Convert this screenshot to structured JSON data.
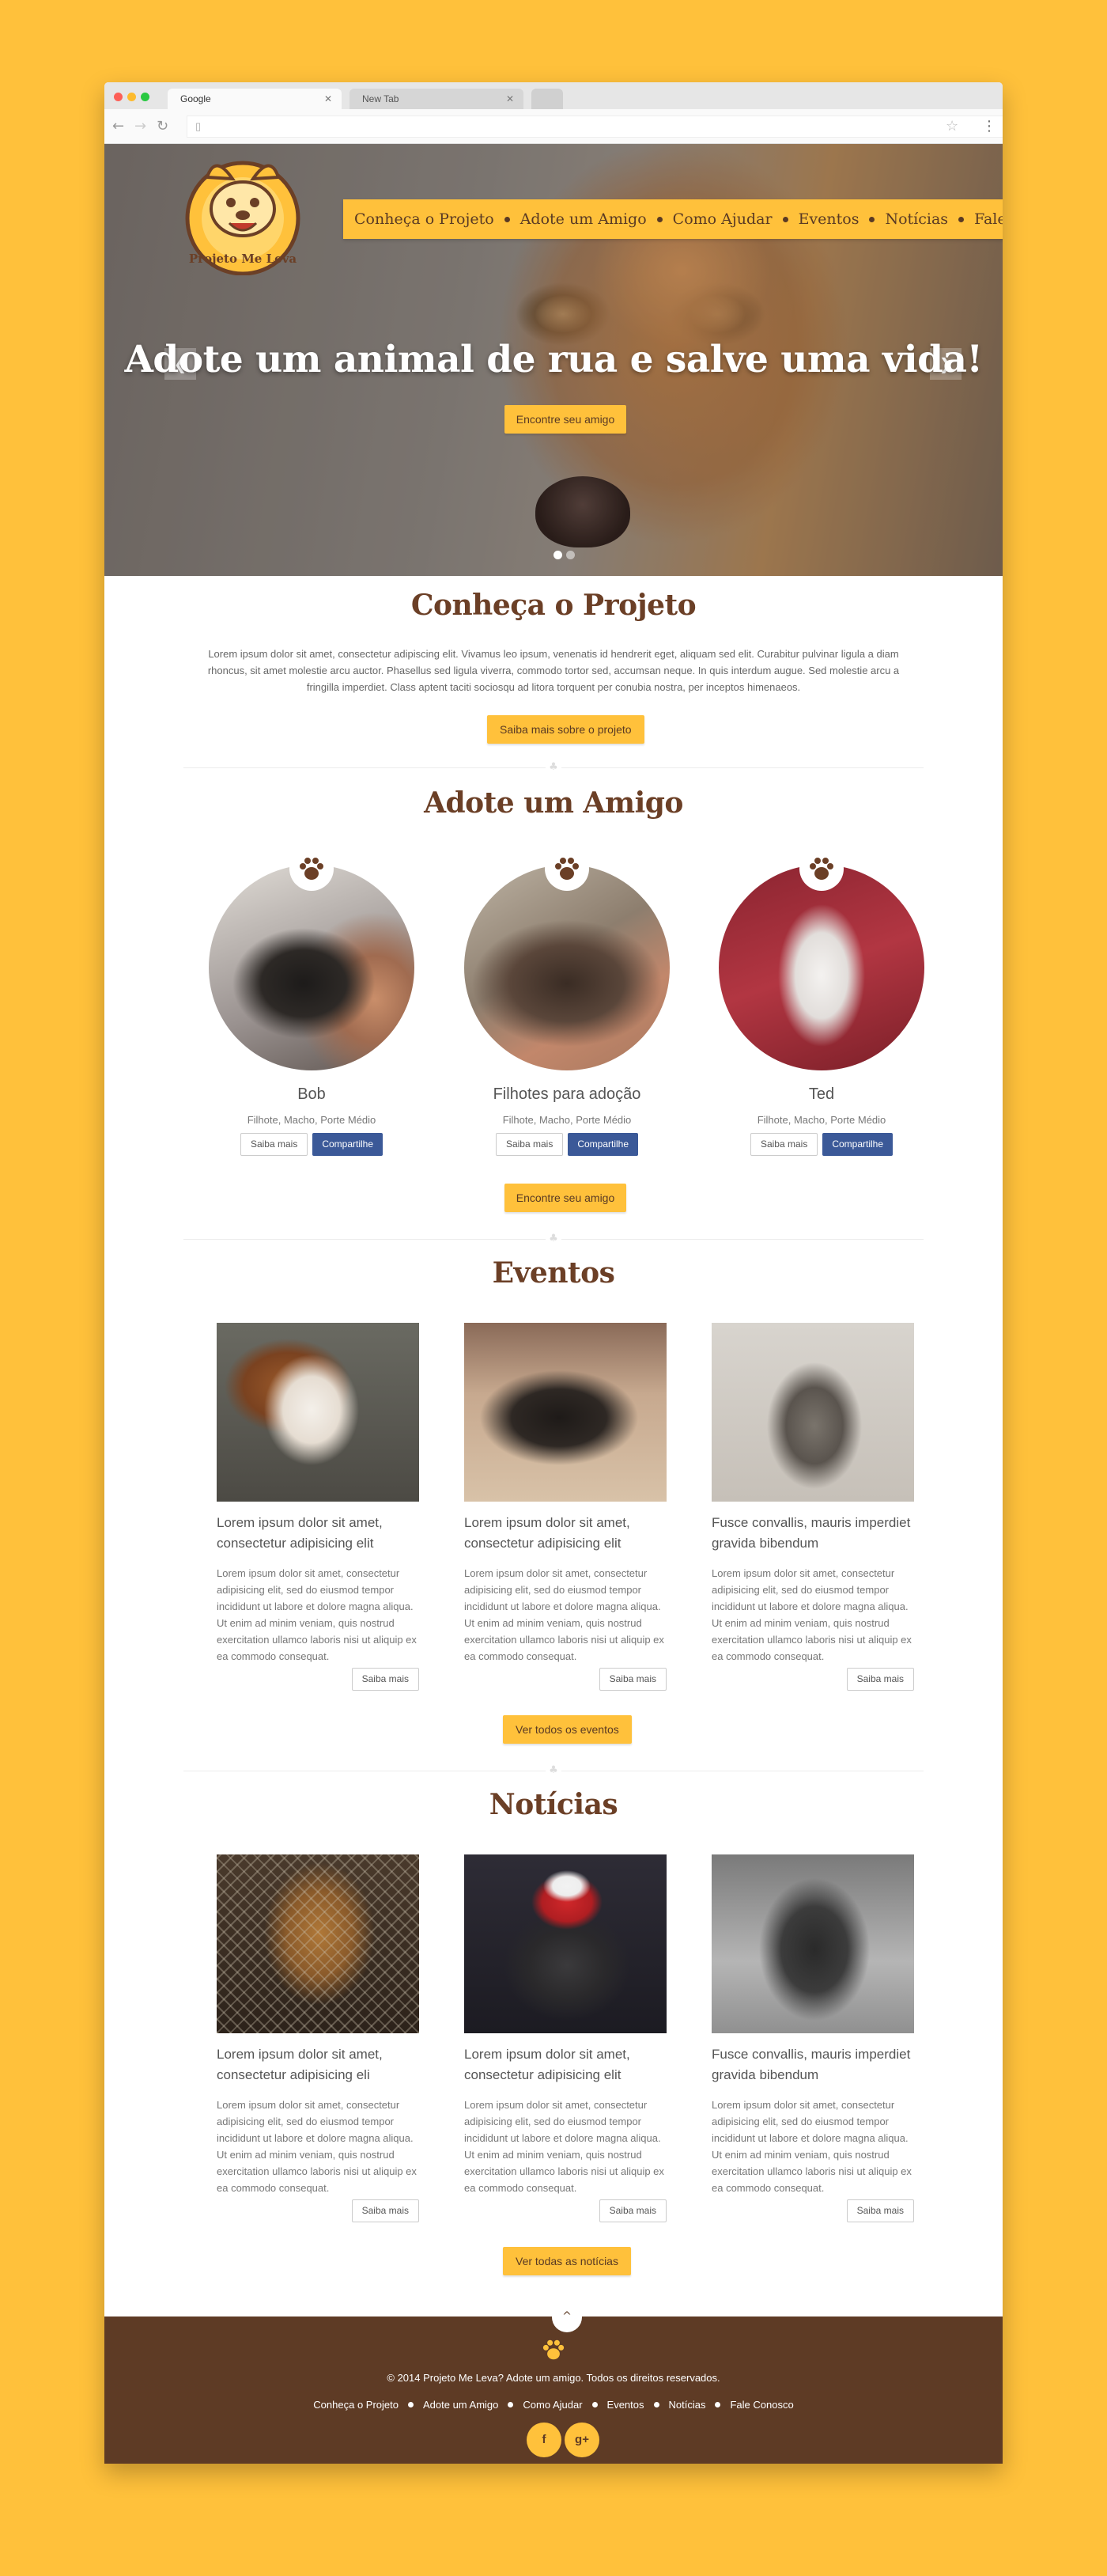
{
  "browser": {
    "tabs": [
      {
        "label": "Google"
      },
      {
        "label": "New Tab"
      }
    ]
  },
  "header": {
    "logo_text": "Projeto Me Leva",
    "menu": [
      {
        "label": "Conheça o Projeto"
      },
      {
        "label": "Adote um Amigo"
      },
      {
        "label": "Como Ajudar"
      },
      {
        "label": "Eventos"
      },
      {
        "label": "Notícias"
      },
      {
        "label": "Fale Conosco"
      }
    ]
  },
  "hero": {
    "title": "Adote um animal de rua e salve uma vida!",
    "button": "Encontre seu amigo",
    "slide_count": 2,
    "active_slide": 1
  },
  "about": {
    "title": "Conheça o Projeto",
    "paragraph": "Lorem ipsum dolor sit amet, consectetur adipiscing elit. Vivamus leo ipsum, venenatis id hendrerit eget, aliquam sed elit. Curabitur pulvinar ligula a diam rhoncus, sit amet molestie arcu auctor. Phasellus sed ligula viverra, commodo tortor sed, accumsan neque. In quis interdum augue. Sed molestie arcu a fringilla imperdiet. Class aptent taciti sociosqu ad litora torquent per conubia nostra, per inceptos himenaeos.",
    "button": "Saiba mais sobre o projeto"
  },
  "adopt": {
    "title": "Adote um Amigo",
    "pets": [
      {
        "name": "Bob",
        "desc": "Filhote, Macho, Porte Médio",
        "more": "Saiba mais",
        "share": "Compartilhe"
      },
      {
        "name": "Filhotes para adoção",
        "desc": "Filhote, Macho, Porte Médio",
        "more": "Saiba mais",
        "share": "Compartilhe"
      },
      {
        "name": "Ted",
        "desc": "Filhote, Macho, Porte Médio",
        "more": "Saiba mais",
        "share": "Compartilhe"
      }
    ],
    "button": "Encontre seu amigo"
  },
  "events": {
    "title": "Eventos",
    "items": [
      {
        "title": "Lorem ipsum dolor sit amet, consectetur adipisicing elit",
        "text": "Lorem ipsum dolor sit amet, consectetur adipisicing elit, sed do eiusmod tempor incididunt ut labore et dolore magna aliqua. Ut enim ad minim veniam, quis nostrud exercitation ullamco laboris nisi ut aliquip ex ea commodo consequat.",
        "more": "Saiba mais"
      },
      {
        "title": "Lorem ipsum dolor sit amet, consectetur adipisicing elit",
        "text": "Lorem ipsum dolor sit amet, consectetur adipisicing elit, sed do eiusmod tempor incididunt ut labore et dolore magna aliqua. Ut enim ad minim veniam, quis nostrud exercitation ullamco laboris nisi ut aliquip ex ea commodo consequat.",
        "more": "Saiba mais"
      },
      {
        "title": "Fusce convallis, mauris imperdiet gravida bibendum",
        "text": "Lorem ipsum dolor sit amet, consectetur adipisicing elit, sed do eiusmod tempor incididunt ut labore et dolore magna aliqua. Ut enim ad minim veniam, quis nostrud exercitation ullamco laboris nisi ut aliquip ex ea commodo consequat.",
        "more": "Saiba mais"
      }
    ],
    "button": "Ver todos os eventos"
  },
  "news": {
    "title": "Notícias",
    "items": [
      {
        "title": "Lorem ipsum dolor sit amet, consectetur adipisicing eli",
        "text": "Lorem ipsum dolor sit amet, consectetur adipisicing elit, sed do eiusmod tempor incididunt ut labore et dolore magna aliqua. Ut enim ad minim veniam, quis nostrud exercitation ullamco laboris nisi ut aliquip ex ea commodo consequat.",
        "more": "Saiba mais"
      },
      {
        "title": "Lorem ipsum dolor sit amet, consectetur adipisicing elit",
        "text": "Lorem ipsum dolor sit amet, consectetur adipisicing elit, sed do eiusmod tempor incididunt ut labore et dolore magna aliqua. Ut enim ad minim veniam, quis nostrud exercitation ullamco laboris nisi ut aliquip ex ea commodo consequat.",
        "more": "Saiba mais"
      },
      {
        "title": "Fusce convallis, mauris imperdiet gravida bibendum",
        "text": "Lorem ipsum dolor sit amet, consectetur adipisicing elit, sed do eiusmod tempor incididunt ut labore et dolore magna aliqua. Ut enim ad minim veniam, quis nostrud exercitation ullamco laboris nisi ut aliquip ex ea commodo consequat.",
        "more": "Saiba mais"
      }
    ],
    "button": "Ver todas as notícias"
  },
  "footer": {
    "copyright": "© 2014 Projeto Me Leva? Adote um amigo. Todos os direitos reservados.",
    "links": [
      {
        "label": "Conheça o Projeto"
      },
      {
        "label": "Adote um Amigo"
      },
      {
        "label": "Como Ajudar"
      },
      {
        "label": "Eventos"
      },
      {
        "label": "Notícias"
      },
      {
        "label": "Fale Conosco"
      }
    ],
    "social": [
      {
        "icon": "facebook-icon",
        "glyph": "f"
      },
      {
        "icon": "google-plus-icon",
        "glyph": "g+"
      }
    ]
  },
  "colors": {
    "background": "#ffc13b",
    "brown": "#5e3b25",
    "heading": "#6b3f26",
    "facebook": "#3b5998"
  }
}
